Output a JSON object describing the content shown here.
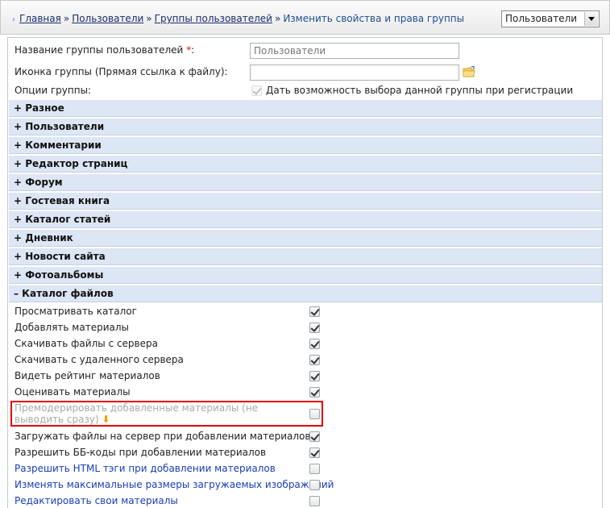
{
  "breadcrumb": {
    "home": "Главная",
    "sep": "»",
    "users": "Пользователи",
    "groups": "Группы пользователей",
    "current": "Изменить свойства и права группы"
  },
  "module_select": {
    "value": "Пользователи"
  },
  "form": {
    "group_name_label": "Название группы пользователей",
    "required_mark": "*",
    "colon": ":",
    "group_name_value": "Пользователи",
    "icon_label": "Иконка группы (Прямая ссылка к файлу):",
    "icon_value": "",
    "options_label": "Опции группы:",
    "registration_option": "Дать возможность выбора данной группы при регистрации"
  },
  "sections": [
    "+ Разное",
    "+ Пользователи",
    "+ Комментарии",
    "+ Редактор страниц",
    "+ Форум",
    "+ Гостевая книга",
    "+ Каталог статей",
    "+ Дневник",
    "+ Новости сайта",
    "+ Фотоальбомы",
    "– Каталог файлов"
  ],
  "permissions": [
    {
      "label": "Просматривать каталог",
      "checked": true
    },
    {
      "label": "Добавлять материалы",
      "checked": true
    },
    {
      "label": "Скачивать файлы с сервера",
      "checked": true
    },
    {
      "label": "Скачивать с удаленного сервера",
      "checked": true
    },
    {
      "label": "Видеть рейтинг материалов",
      "checked": true
    },
    {
      "label": "Оценивать материалы",
      "checked": true
    },
    {
      "label": "Премодерировать добавленные материалы (не выводить сразу)",
      "checked": false
    },
    {
      "label": "Загружать файлы на сервер при добавлении материалов",
      "checked": true
    },
    {
      "label": "Разрешить ББ-коды при добавлении материалов",
      "checked": true
    },
    {
      "label": "Разрешить HTML тэги при добавлении материалов",
      "checked": false
    },
    {
      "label": "Изменять максимальные размеры загружаемых изображений",
      "checked": false
    },
    {
      "label": "Редактировать свои материалы",
      "checked": false
    }
  ],
  "highlight_marker": "⬇",
  "colors": {
    "accent_red": "#e00000",
    "section_bg": "#dce6f4",
    "link_blue": "#1a3dbd"
  }
}
